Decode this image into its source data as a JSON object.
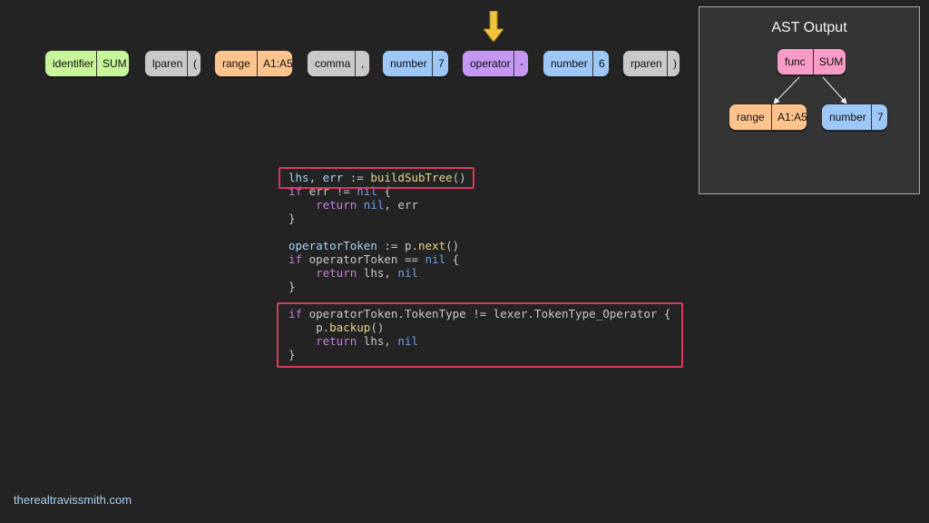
{
  "tokens": [
    {
      "kind": "identifier",
      "value": "SUM",
      "color": "#c6f59a"
    },
    {
      "kind": "lparen",
      "value": "(",
      "color": "#c9c9c9"
    },
    {
      "kind": "range",
      "value": "A1:A5",
      "color": "#ffc48e"
    },
    {
      "kind": "comma",
      "value": ",",
      "color": "#c9c9c9"
    },
    {
      "kind": "number",
      "value": "7",
      "color": "#9cc7f7"
    },
    {
      "kind": "operator",
      "value": "-",
      "color": "#c498f2"
    },
    {
      "kind": "number",
      "value": "6",
      "color": "#9cc7f7"
    },
    {
      "kind": "rparen",
      "value": ")",
      "color": "#c9c9c9"
    }
  ],
  "pointer": {
    "icon": "down-arrow-icon",
    "color": "#f2c33c"
  },
  "ast": {
    "title": "AST Output",
    "root": {
      "kind": "func",
      "value": "SUM",
      "color": "#f79cc6"
    },
    "left": {
      "kind": "range",
      "value": "A1:A5",
      "color": "#ffc48e"
    },
    "right": {
      "kind": "number",
      "value": "7",
      "color": "#9cc7f7"
    }
  },
  "code": {
    "lines": [
      [
        {
          "t": "lhs",
          "c": "id"
        },
        {
          "t": ", ",
          "c": "op"
        },
        {
          "t": "err",
          "c": "id"
        },
        {
          "t": " := ",
          "c": "op"
        },
        {
          "t": "buildSubTree",
          "c": "fn"
        },
        {
          "t": "()",
          "c": "op"
        }
      ],
      [
        {
          "t": "if",
          "c": "kw"
        },
        {
          "t": " err != ",
          "c": "op"
        },
        {
          "t": "nil",
          "c": "nil"
        },
        {
          "t": " {",
          "c": "op"
        }
      ],
      [
        {
          "t": "    ",
          "c": "op"
        },
        {
          "t": "return",
          "c": "kw"
        },
        {
          "t": " ",
          "c": "op"
        },
        {
          "t": "nil",
          "c": "nil"
        },
        {
          "t": ", err",
          "c": "op"
        }
      ],
      [
        {
          "t": "}",
          "c": "op"
        }
      ],
      [],
      [
        {
          "t": "operatorToken",
          "c": "id"
        },
        {
          "t": " := p.",
          "c": "op"
        },
        {
          "t": "next",
          "c": "fn"
        },
        {
          "t": "()",
          "c": "op"
        }
      ],
      [
        {
          "t": "if",
          "c": "kw"
        },
        {
          "t": " operatorToken == ",
          "c": "op"
        },
        {
          "t": "nil",
          "c": "nil"
        },
        {
          "t": " {",
          "c": "op"
        }
      ],
      [
        {
          "t": "    ",
          "c": "op"
        },
        {
          "t": "return",
          "c": "kw"
        },
        {
          "t": " lhs, ",
          "c": "op"
        },
        {
          "t": "nil",
          "c": "nil"
        }
      ],
      [
        {
          "t": "}",
          "c": "op"
        }
      ],
      [],
      [
        {
          "t": "if",
          "c": "kw"
        },
        {
          "t": " operatorToken.TokenType != lexer.TokenType_Operator {",
          "c": "op"
        }
      ],
      [
        {
          "t": "    p.",
          "c": "op"
        },
        {
          "t": "backup",
          "c": "fn"
        },
        {
          "t": "()",
          "c": "op"
        }
      ],
      [
        {
          "t": "    ",
          "c": "op"
        },
        {
          "t": "return",
          "c": "kw"
        },
        {
          "t": " lhs, ",
          "c": "op"
        },
        {
          "t": "nil",
          "c": "nil"
        }
      ],
      [
        {
          "t": "}",
          "c": "op"
        }
      ]
    ]
  },
  "highlight_color": "#d83a5c",
  "footer": "therealtravissmith.com"
}
